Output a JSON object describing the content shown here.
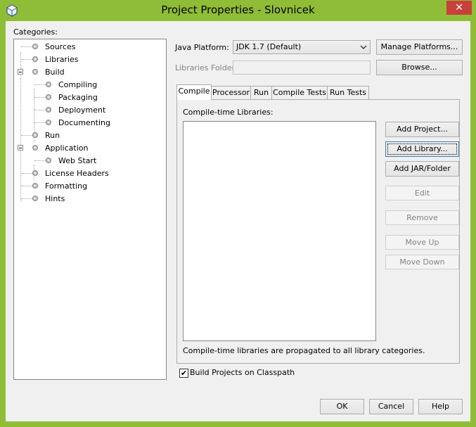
{
  "window": {
    "title": "Project Properties - Slovnicek",
    "close_glyph": "✕",
    "accent_color": "#8fbd38",
    "close_color": "#c7413a"
  },
  "categories": {
    "label": "Categories:",
    "items": [
      {
        "label": "Sources"
      },
      {
        "label": "Libraries"
      },
      {
        "label": "Build"
      },
      {
        "label": "Compiling"
      },
      {
        "label": "Packaging"
      },
      {
        "label": "Deployment"
      },
      {
        "label": "Documenting"
      },
      {
        "label": "Run"
      },
      {
        "label": "Application"
      },
      {
        "label": "Web Start"
      },
      {
        "label": "License Headers"
      },
      {
        "label": "Formatting"
      },
      {
        "label": "Hints"
      }
    ],
    "selected": "Libraries"
  },
  "platform": {
    "label": "Java Platform:",
    "value": "JDK 1.7 (Default)",
    "manage_button": "Manage Platforms..."
  },
  "libraries_folder": {
    "label": "Libraries Folder:",
    "value": "",
    "browse_button": "Browse..."
  },
  "tabs": [
    {
      "label": "Compile",
      "active": true
    },
    {
      "label": "Processor"
    },
    {
      "label": "Run"
    },
    {
      "label": "Compile Tests"
    },
    {
      "label": "Run Tests"
    }
  ],
  "compile": {
    "list_label": "Compile-time Libraries:",
    "note": "Compile-time libraries are propagated to all library categories.",
    "buttons": {
      "add_project": "Add Project...",
      "add_library": "Add Library...",
      "add_jar": "Add JAR/Folder",
      "edit": "Edit",
      "remove": "Remove",
      "move_up": "Move Up",
      "move_down": "Move Down"
    }
  },
  "build_classpath": {
    "label": "Build Projects on Classpath",
    "checked": "✔"
  },
  "footer": {
    "ok": "OK",
    "cancel": "Cancel",
    "help": "Help"
  }
}
